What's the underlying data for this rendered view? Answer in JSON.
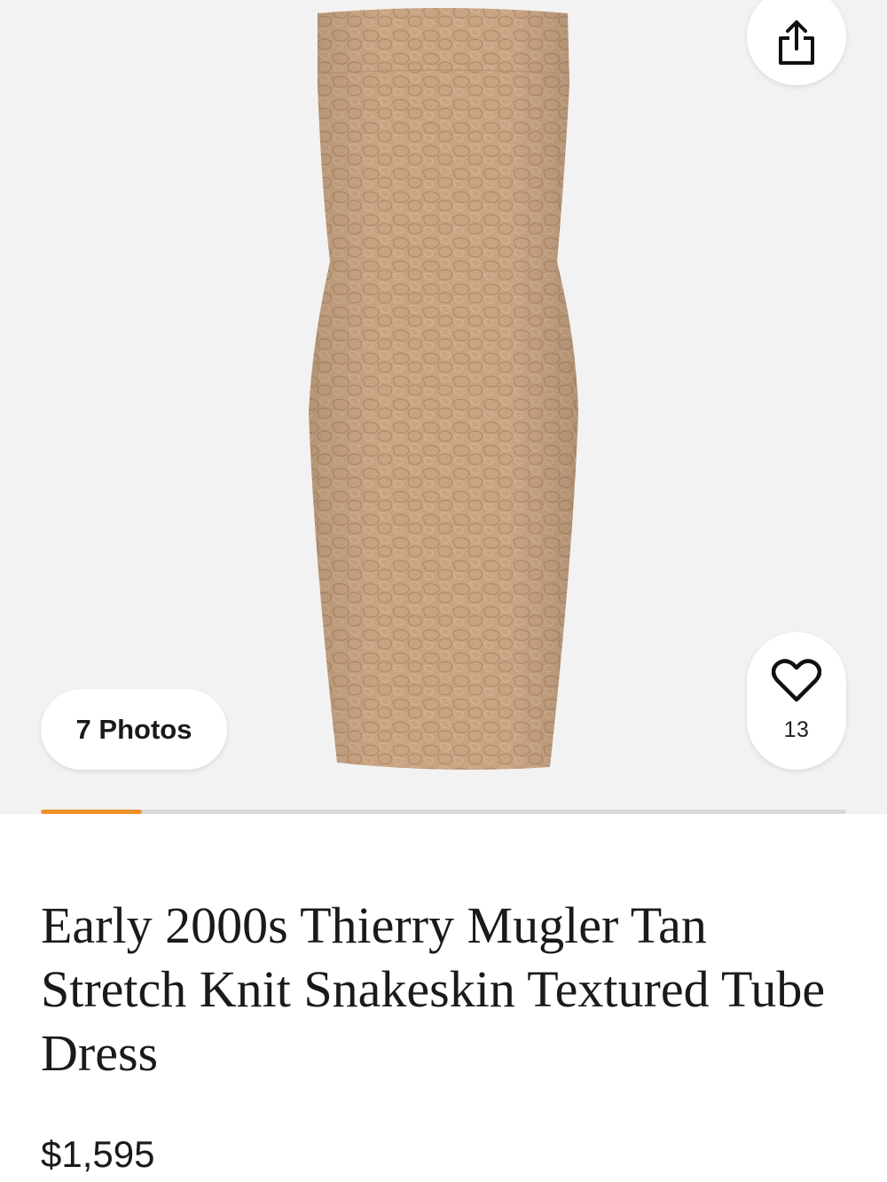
{
  "gallery": {
    "photos_label": "7 Photos",
    "favorite_count": "13",
    "image_index_progress": 0.125,
    "colors": {
      "accent": "#f0902c",
      "track": "#d9d9d9",
      "background": "#f2f2f2",
      "dress": "#c9a483"
    }
  },
  "icons": {
    "share": "share-icon",
    "favorite": "heart-icon"
  },
  "product": {
    "title": "Early 2000s Thierry Mugler Tan Stretch Knit Snakeskin Textured Tube Dress",
    "price": "$1,595"
  }
}
